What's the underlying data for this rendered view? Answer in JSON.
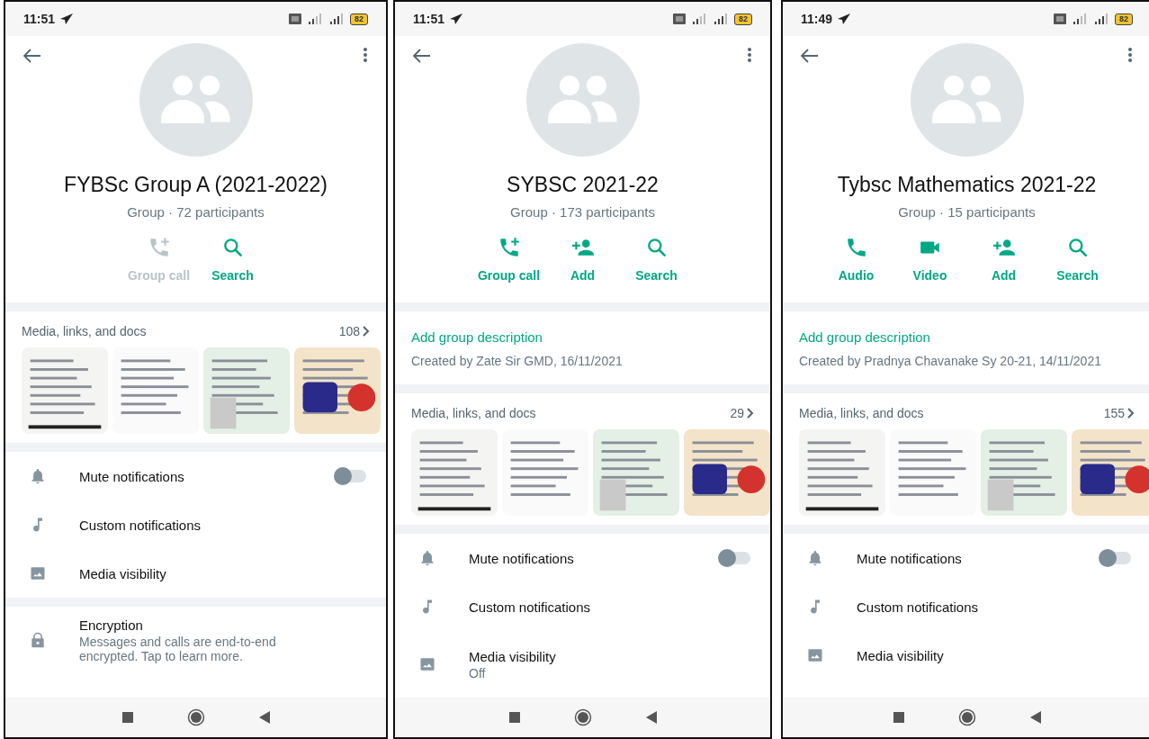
{
  "phones": [
    {
      "status": {
        "time": "11:51",
        "battery": "82"
      },
      "name": "FYBSc Group A (2021-2022)",
      "subtitle": "Group · 72 participants",
      "actions": [
        {
          "kind": "call",
          "label": "Group call",
          "disabled": true
        },
        {
          "kind": "search",
          "label": "Search",
          "disabled": false
        }
      ],
      "media": {
        "title": "Media, links, and docs",
        "count": "108"
      },
      "settings": [
        {
          "kind": "mute",
          "label": "Mute notifications",
          "on": false
        },
        {
          "kind": "custom",
          "label": "Custom notifications"
        },
        {
          "kind": "visibility",
          "label": "Media visibility"
        },
        {
          "kind": "encryption",
          "label": "Encryption",
          "sub": "Messages and calls are end-to-end encrypted. Tap to learn more."
        }
      ]
    },
    {
      "status": {
        "time": "11:51",
        "battery": "82"
      },
      "name": "SYBSC 2021-22",
      "subtitle": "Group · 173 participants",
      "actions": [
        {
          "kind": "call",
          "label": "Group call",
          "disabled": false
        },
        {
          "kind": "add",
          "label": "Add",
          "disabled": false
        },
        {
          "kind": "search",
          "label": "Search",
          "disabled": false
        }
      ],
      "description": {
        "link": "Add group description",
        "created": "Created by Zate Sir GMD, 16/11/2021"
      },
      "media": {
        "title": "Media, links, and docs",
        "count": "29"
      },
      "settings": [
        {
          "kind": "mute",
          "label": "Mute notifications",
          "on": false
        },
        {
          "kind": "custom",
          "label": "Custom notifications"
        },
        {
          "kind": "visibility",
          "label": "Media visibility",
          "sub": "Off"
        }
      ]
    },
    {
      "status": {
        "time": "11:49",
        "battery": "82"
      },
      "name": "Tybsc Mathematics 2021-22",
      "subtitle": "Group · 15 participants",
      "actions": [
        {
          "kind": "audio",
          "label": "Audio",
          "disabled": false
        },
        {
          "kind": "video",
          "label": "Video",
          "disabled": false
        },
        {
          "kind": "add",
          "label": "Add",
          "disabled": false
        },
        {
          "kind": "search",
          "label": "Search",
          "disabled": false
        }
      ],
      "description": {
        "link": "Add group description",
        "created": "Created by Pradnya Chavanake Sy 20-21, 14/11/2021"
      },
      "media": {
        "title": "Media, links, and docs",
        "count": "155"
      },
      "settings": [
        {
          "kind": "mute",
          "label": "Mute notifications",
          "on": false
        },
        {
          "kind": "custom",
          "label": "Custom notifications"
        },
        {
          "kind": "visibility",
          "label": "Media visibility"
        }
      ]
    }
  ]
}
